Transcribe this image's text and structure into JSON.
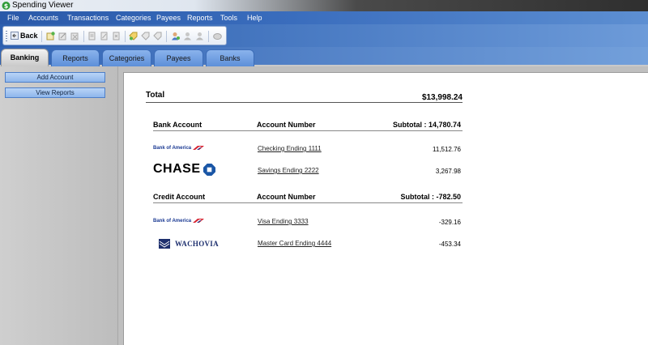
{
  "window": {
    "title": "Spending Viewer"
  },
  "menu": [
    "File",
    "Accounts",
    "Transactions",
    "Categories",
    "Payees",
    "Reports",
    "Tools",
    "Help"
  ],
  "toolbar": {
    "back_label": "Back"
  },
  "tabs": [
    "Banking",
    "Reports",
    "Categories",
    "Payees",
    "Banks"
  ],
  "sidebar": {
    "add_account": "Add Account",
    "view_reports": "View Reports"
  },
  "summary": {
    "total_label": "Total",
    "total_value": "$13,998.24"
  },
  "bank_section": {
    "col_account": "Bank Account",
    "col_number": "Account Number",
    "subtotal": "Subtotal : 14,780.74",
    "rows": [
      {
        "logo": "Bank of America",
        "account": "Checking Ending 1111",
        "amount": "11,512.76"
      },
      {
        "logo": "CHASE",
        "account": "Savings Ending 2222",
        "amount": "3,267.98"
      }
    ]
  },
  "credit_section": {
    "col_account": "Credit Account",
    "col_number": "Account Number",
    "subtotal": "Subtotal : -782.50",
    "rows": [
      {
        "logo": "Bank of America",
        "account": "Visa Ending 3333",
        "amount": "-329.16"
      },
      {
        "logo": "WACHOVIA",
        "account": "Master Card Ending 4444",
        "amount": "-453.34"
      }
    ]
  },
  "colors": {
    "menu_blue": "#2a59a9",
    "tab_blue": "#8ab3ec",
    "boa_blue": "#1b3a93",
    "boa_red": "#d5202e",
    "chase_blue": "#1a56a6",
    "wachovia_blue": "#1d2f6e"
  }
}
